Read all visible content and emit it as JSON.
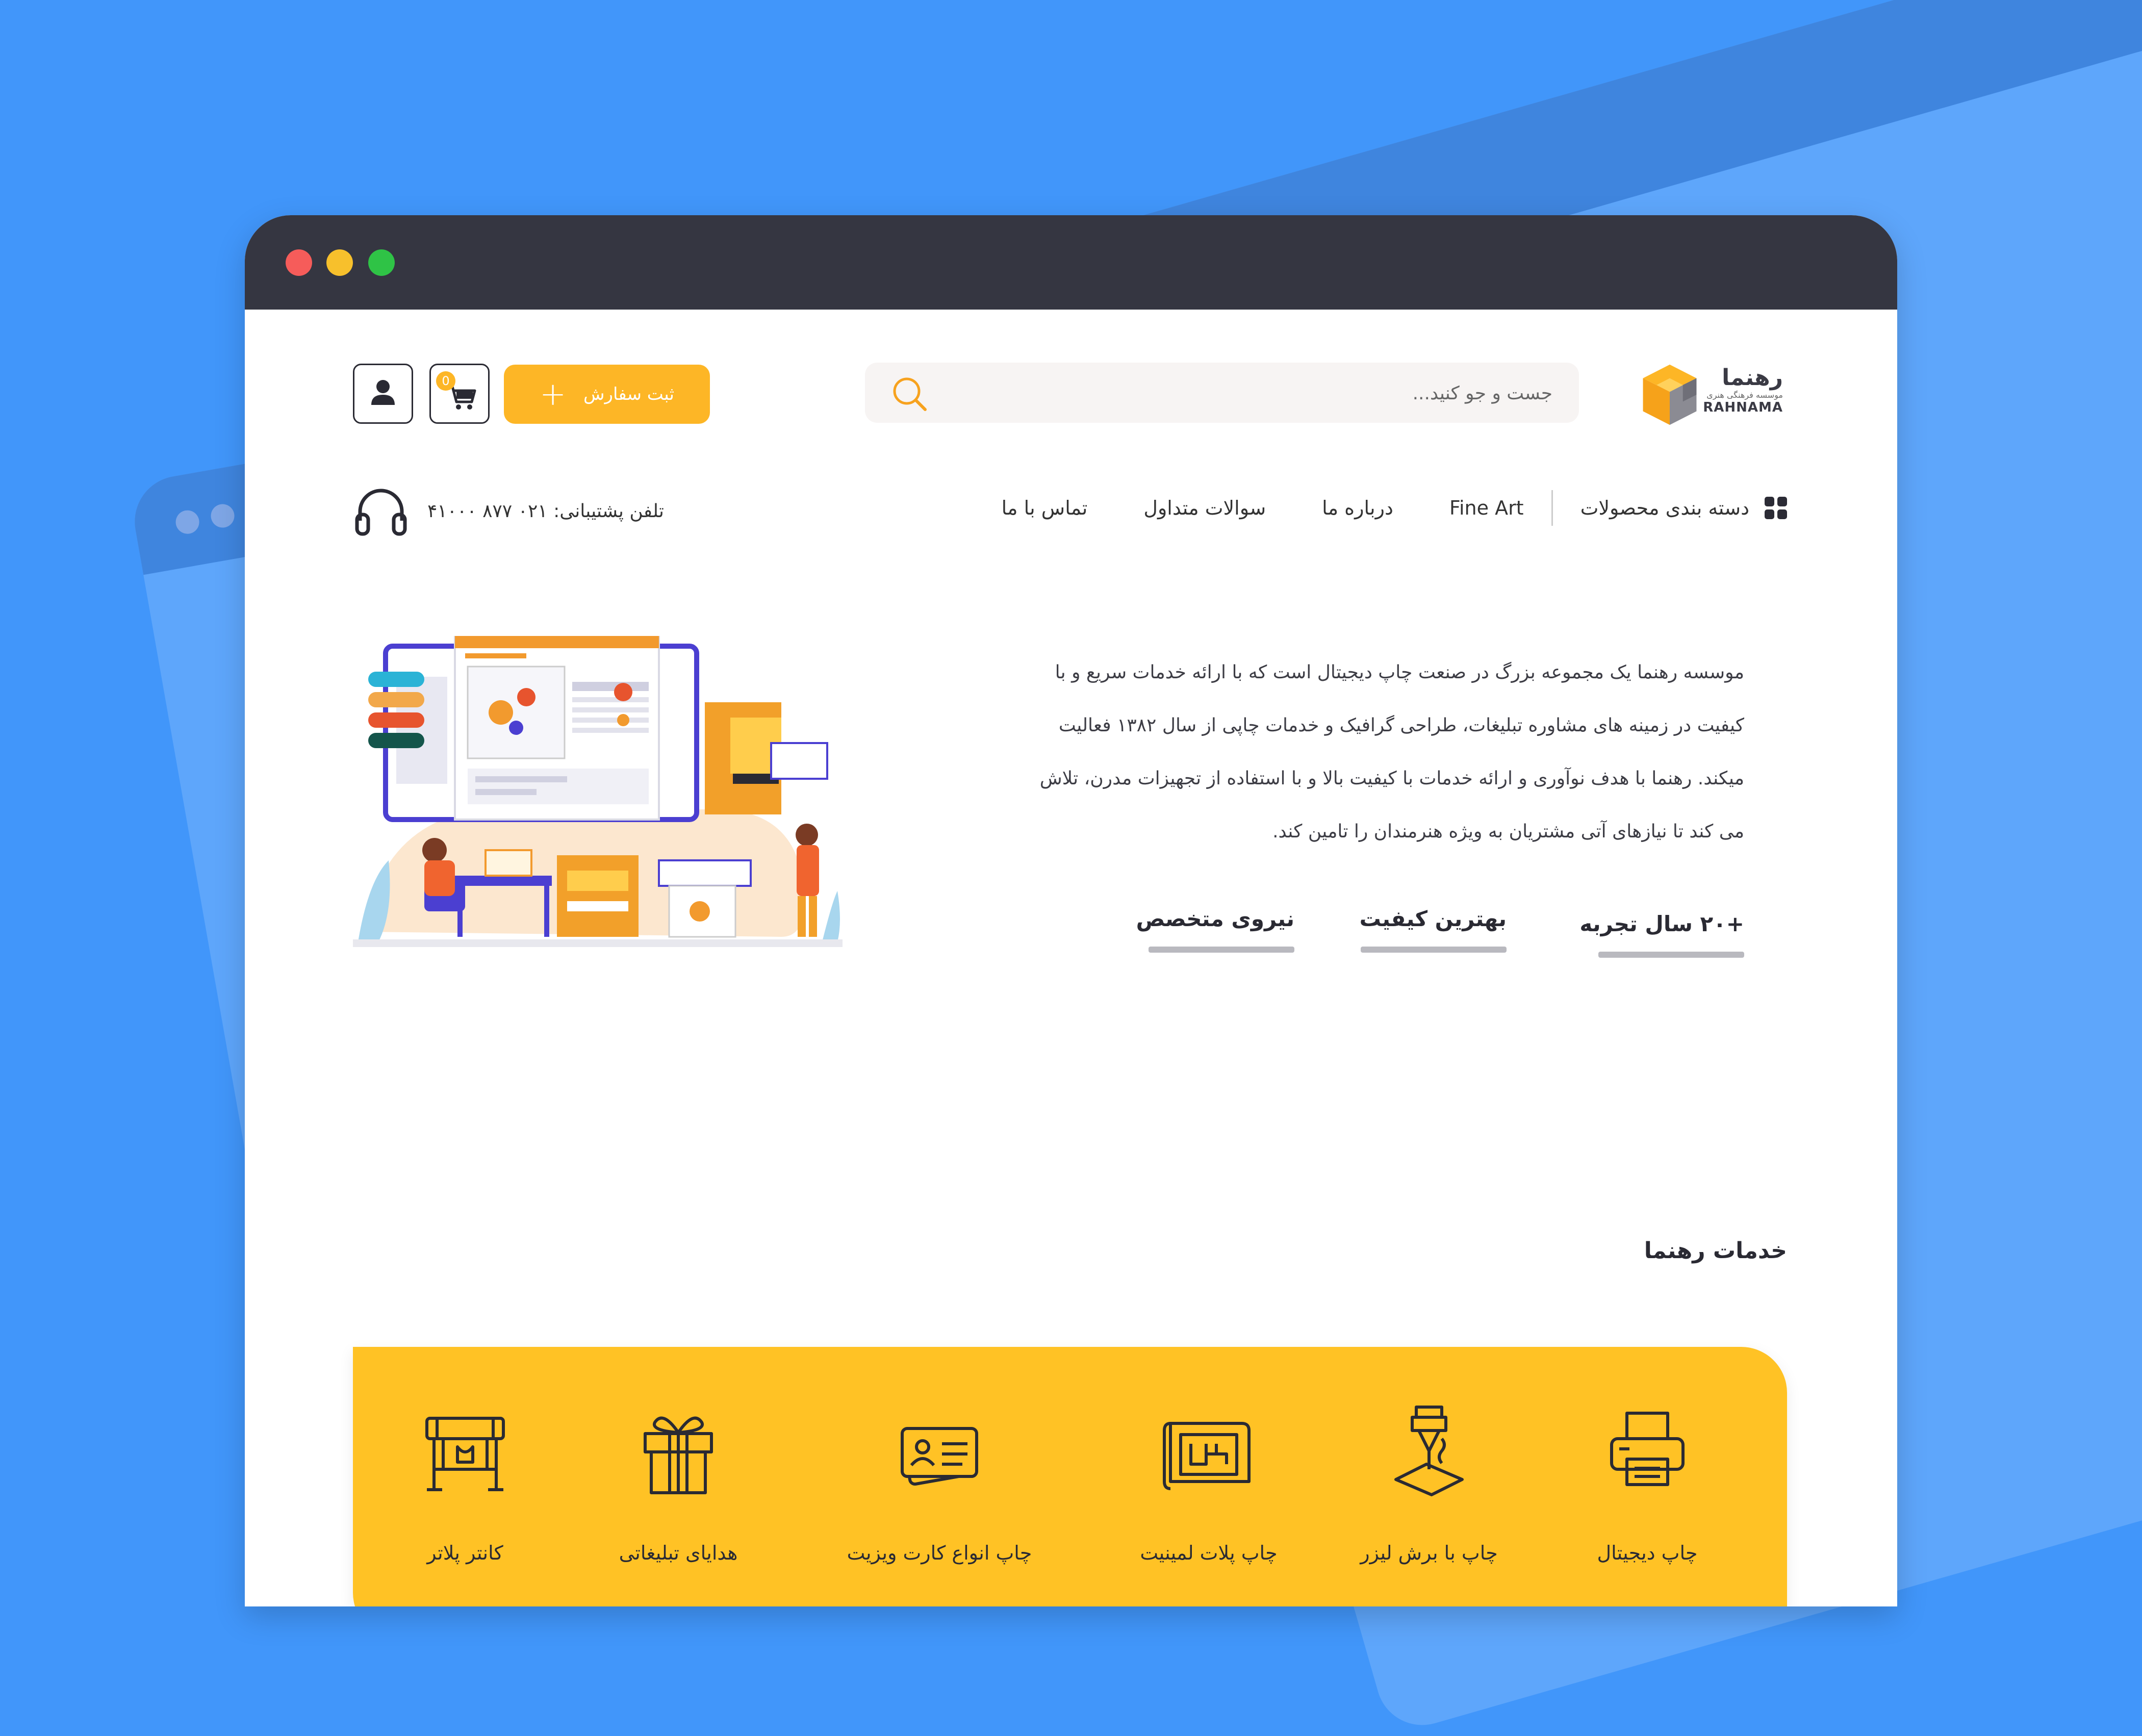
{
  "colors": {
    "background": "#4196fa",
    "titlebar": "#353641",
    "accent": "#fdb626",
    "services_panel": "#ffc225",
    "text": "#2a2a33"
  },
  "window_controls": [
    "close",
    "minimize",
    "maximize"
  ],
  "header": {
    "logo": {
      "name_fa": "رهنما",
      "tagline_fa": "موسسه فرهنگی هنری",
      "name_en": "RAHNAMA",
      "icon": "cube-logo-icon"
    },
    "search": {
      "placeholder": "جست و جو کنید...",
      "icon": "search-icon"
    },
    "order_button": {
      "label": "ثبت سفارش",
      "icon": "plus-icon"
    },
    "cart": {
      "icon": "cart-icon",
      "count": "0"
    },
    "user": {
      "icon": "user-icon"
    }
  },
  "nav": {
    "categories_label": "دسته بندی محصولات",
    "items": [
      "Fine Art",
      "درباره ما",
      "سوالات متداول",
      "تماس با ما"
    ]
  },
  "support": {
    "label": "تلفن پشتیبانی:",
    "phone": "۰۲۱ ۸۷۷ ۴۱۰۰۰",
    "icon": "headset-icon"
  },
  "hero": {
    "about_lines": [
      "موسسه رهنما یک مجموعه بزرگ در صنعت  چاپ دیجیتال است که با ارائه خدمات سریع و با",
      "کیفیت در زمینه های مشاوره تبلیغات،  طراحی گرافیک  و خدمات چاپی از سال ۱۳۸۲ فعالیت",
      "میکند. رهنما با هدف نوآوری و ارائه خدمات با کیفیت بالا و با استفاده از تجهیزات مدرن، تلاش",
      "می کند تا نیازهای آتی مشتریان به ویژه هنرمندان را تامین کند."
    ],
    "stats": [
      "+۲۰ سال تجربه",
      "بهترین کیفیت",
      "نیروی متخصص"
    ]
  },
  "services": {
    "title": "خدمات رهنما",
    "items": [
      {
        "label": "چاپ دیجیتال",
        "icon": "printer-icon"
      },
      {
        "label": "چاپ با برش لیزر",
        "icon": "laser-cutter-icon"
      },
      {
        "label": "چاپ پلات لمینیت",
        "icon": "blueprint-icon"
      },
      {
        "label": "چاپ انواع کارت ویزیت",
        "icon": "business-card-icon"
      },
      {
        "label": "هدایای تبلیغاتی",
        "icon": "gift-icon"
      },
      {
        "label": "کانتر پلاتر",
        "icon": "plotter-icon"
      }
    ]
  }
}
